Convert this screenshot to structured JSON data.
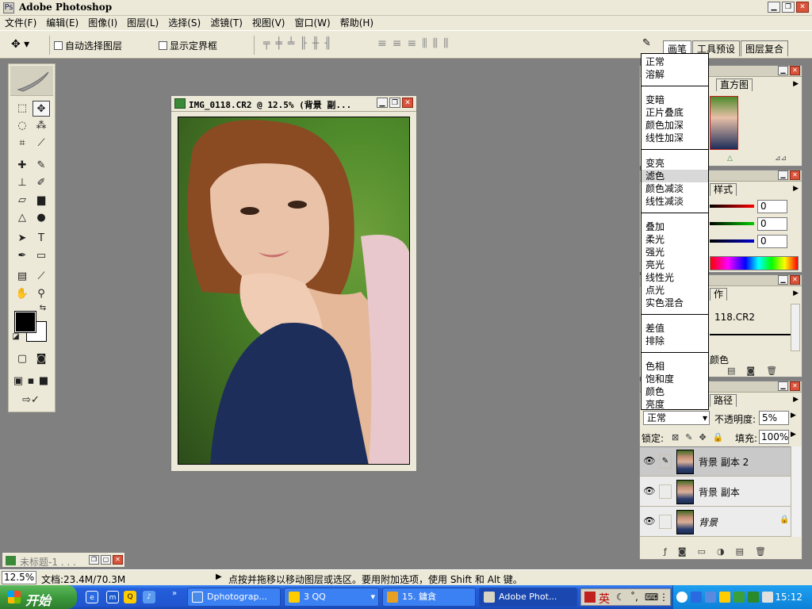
{
  "app": {
    "title": "Adobe Photoshop",
    "icon": "photoshop-icon"
  },
  "menu": [
    "文件(F)",
    "编辑(E)",
    "图像(I)",
    "图层(L)",
    "选择(S)",
    "滤镜(T)",
    "视图(V)",
    "窗口(W)",
    "帮助(H)"
  ],
  "options": {
    "auto_select": "自动选择图层",
    "show_bounds": "显示定界框",
    "well_tabs": [
      "画笔",
      "工具预设",
      "图层复合"
    ]
  },
  "document": {
    "title": "IMG_0118.CR2 @ 12.5% (背景 副..."
  },
  "minimized": {
    "title": "未标题-1 . . ."
  },
  "palettes": {
    "navigator_tab": "直方图",
    "color_tab": "样式",
    "color_values": [
      "0",
      "0",
      "0"
    ],
    "history_tab": "作",
    "history_item": "118.CR2",
    "history_bottom": "颜色",
    "layers_tab": "路径",
    "blend_mode": "正常",
    "opacity_label": "不透明度:",
    "opacity_value": "5%",
    "lock_label": "锁定:",
    "fill_label": "填充:",
    "fill_value": "100%",
    "layers": [
      {
        "name": "背景 副本 2",
        "selected": true
      },
      {
        "name": "背景 副本",
        "selected": false
      },
      {
        "name": "背景",
        "selected": false,
        "locked": true
      }
    ]
  },
  "blend_menu": {
    "groups": [
      [
        "正常",
        "溶解"
      ],
      [
        "变暗",
        "正片叠底",
        "颜色加深",
        "线性加深"
      ],
      [
        "变亮",
        "滤色",
        "颜色减淡",
        "线性减淡"
      ],
      [
        "叠加",
        "柔光",
        "强光",
        "亮光",
        "线性光",
        "点光",
        "实色混合"
      ],
      [
        "差值",
        "排除"
      ],
      [
        "色相",
        "饱和度",
        "颜色",
        "亮度"
      ]
    ],
    "highlighted": "滤色"
  },
  "status": {
    "zoom": "12.5%",
    "doc_info": "文档:23.4M/70.3M",
    "hint": "点按并拖移以移动图层或选区。要用附加选项，使用 Shift 和 Alt 键。"
  },
  "taskbar": {
    "start": "开始",
    "tasks": [
      {
        "label": "Dphotograp...",
        "active": false
      },
      {
        "label": "3 QQ",
        "active": false
      },
      {
        "label": "15. 鏞貪",
        "active": false
      },
      {
        "label": "Adobe Phot...",
        "active": true
      }
    ],
    "ime": "英",
    "clock": "15:12"
  },
  "colors": {
    "chrome": "#ece9d8",
    "workspace": "#808080",
    "taskbar": "#245edb",
    "start": "#3c9a3c"
  }
}
